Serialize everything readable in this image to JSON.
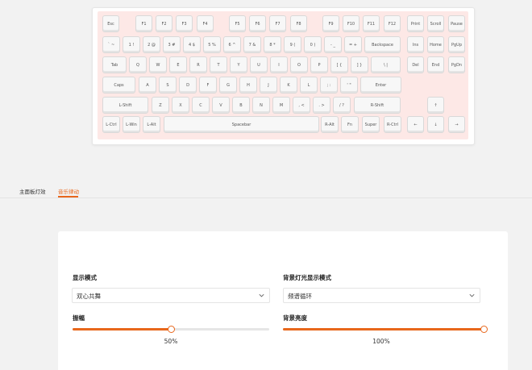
{
  "keyboard": {
    "row1": [
      "Esc",
      "F1",
      "F2",
      "F3",
      "F4",
      "F5",
      "F6",
      "F7",
      "F8",
      "F9",
      "F10",
      "F11",
      "F12",
      "Print",
      "Scroll",
      "Pause"
    ],
    "row2": [
      "` ~",
      "1 !",
      "2 @",
      "3 #",
      "4 $",
      "5 %",
      "6 ^",
      "7 &",
      "8 *",
      "9 (",
      "0 )",
      "- _",
      "= +",
      "Backspace",
      "Ins",
      "Home",
      "PgUp"
    ],
    "row3": [
      "Tab",
      "Q",
      "W",
      "E",
      "R",
      "T",
      "Y",
      "U",
      "I",
      "O",
      "P",
      "[ {",
      "] }",
      "\\ |",
      "Del",
      "End",
      "PgDn"
    ],
    "row4": [
      "Caps",
      "A",
      "S",
      "D",
      "F",
      "G",
      "H",
      "J",
      "K",
      "L",
      "; :",
      "' \"",
      "Enter"
    ],
    "row5": [
      "L-Shift",
      "Z",
      "X",
      "C",
      "V",
      "B",
      "N",
      "M",
      ", <",
      ". >",
      "/ ?",
      "R-Shift",
      "↑"
    ],
    "row6": [
      "L-Ctrl",
      "L-Win",
      "L-Alt",
      "Spacebar",
      "R-Alt",
      "Fn",
      "Super",
      "R-Ctrl",
      "←",
      "↓",
      "→"
    ]
  },
  "tabs": [
    {
      "label": "主面板灯效"
    },
    {
      "label": "音乐律动"
    }
  ],
  "panel": {
    "display_mode": {
      "label": "显示模式",
      "value": "双心共舞"
    },
    "bg_mode": {
      "label": "背景灯光显示模式",
      "value": "频谱循环"
    },
    "amplitude": {
      "label": "振幅",
      "value_text": "50%",
      "fraction": 0.5
    },
    "bg_brightness": {
      "label": "背景亮度",
      "value_text": "100%",
      "fraction": 1.0
    }
  },
  "colors": {
    "accent": "#e8671c",
    "keyboard_plate": "#fde8e6"
  }
}
